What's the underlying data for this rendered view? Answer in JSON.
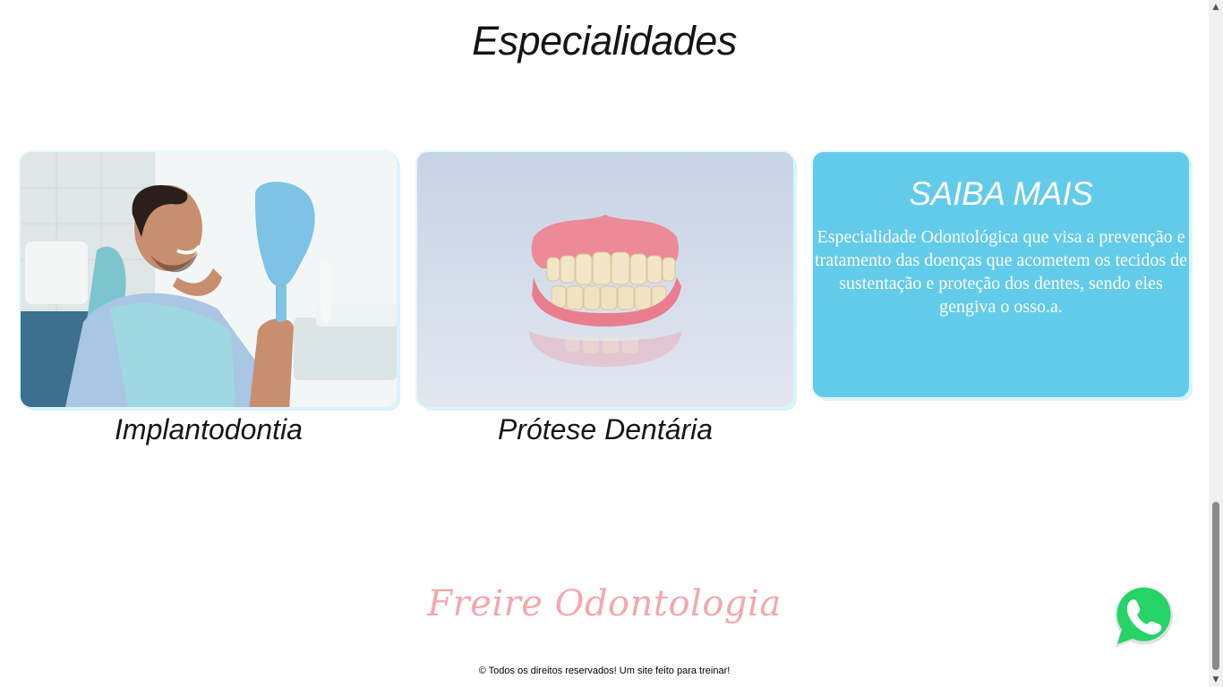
{
  "section": {
    "title": "Especialidades"
  },
  "cards": [
    {
      "caption": "Implantodontia",
      "image_alt": "Homem sorrindo segurando espelho no consultório odontológico"
    },
    {
      "caption": "Prótese Dentária",
      "image_alt": "Prótese dentária completa"
    }
  ],
  "saiba_mais": {
    "title": "SAIBA MAIS",
    "text": "Especialidade Odontológica que visa a prevenção e tratamento das doenças que acometem os tecidos de sustentação e proteção dos dentes, sendo eles gengiva o osso.a."
  },
  "footer": {
    "brand": "Freire Odontologia",
    "copyright": "© Todos os direitos reservados! Um site feito para treinar!"
  },
  "colors": {
    "accent_card": "#63cbea",
    "brand_pink": "#f2a8ae",
    "whatsapp_green": "#25d366"
  },
  "icons": {
    "whatsapp": "whatsapp-icon"
  }
}
